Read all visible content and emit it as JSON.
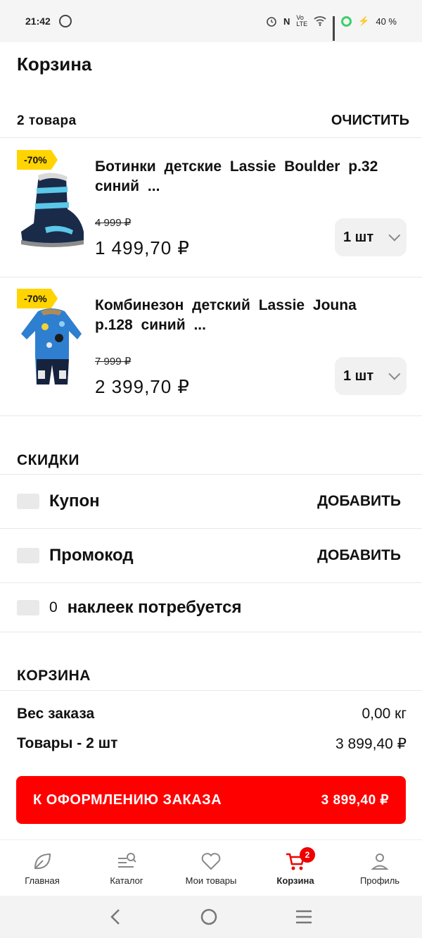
{
  "status": {
    "time": "21:42",
    "battery": "40 %"
  },
  "header": {
    "title": "Корзина"
  },
  "cart": {
    "count_label": "2 товара",
    "clear_label": "ОЧИСТИТЬ"
  },
  "items": [
    {
      "badge": "-70%",
      "title": "Ботинки детские Lassie Boulder р.32 синий ...",
      "old_price": "4 999 ₽",
      "price": "1 499,70 ₽",
      "qty": "1 шт"
    },
    {
      "badge": "-70%",
      "title": "Комбинезон детский Lassie Jouna р.128 синий ...",
      "old_price": "7 999 ₽",
      "price": "2 399,70 ₽",
      "qty": "1 шт"
    }
  ],
  "discounts": {
    "heading": "СКИДКИ",
    "coupon_label": "Купон",
    "coupon_action": "ДОБАВИТЬ",
    "promo_label": "Промокод",
    "promo_action": "ДОБАВИТЬ",
    "stickers_count": "0",
    "stickers_label": "наклеек потребуется"
  },
  "summary": {
    "heading": "КОРЗИНА",
    "weight_label": "Вес заказа",
    "weight_value": "0,00 кг",
    "goods_label": "Товары - 2 шт",
    "goods_value": "3 899,40 ₽"
  },
  "checkout": {
    "label": "К ОФОРМЛЕНИЮ ЗАКАЗА",
    "total": "3 899,40 ₽"
  },
  "tabs": [
    {
      "label": "Главная",
      "icon": "leaf-icon"
    },
    {
      "label": "Каталог",
      "icon": "catalog-search-icon"
    },
    {
      "label": "Мои товары",
      "icon": "heart-icon"
    },
    {
      "label": "Корзина",
      "icon": "cart-icon",
      "badge": "2"
    },
    {
      "label": "Профиль",
      "icon": "user-icon"
    }
  ],
  "colors": {
    "accent": "#ff0000",
    "badge": "#ffd400"
  }
}
